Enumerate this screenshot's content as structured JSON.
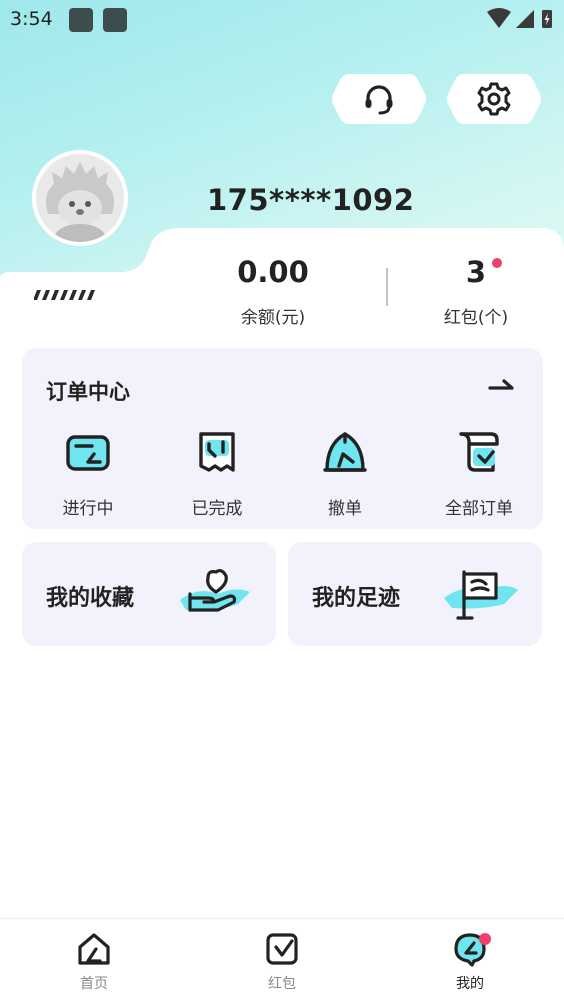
{
  "status_bar": {
    "time": "3:54"
  },
  "header": {
    "icons": {
      "support": "headset-icon",
      "settings": "gear-icon"
    },
    "phone": "175****1092"
  },
  "stats": {
    "balance": {
      "value": "0.00",
      "label": "余额(元)"
    },
    "redpacket": {
      "value": "3",
      "label": "红包(个)"
    }
  },
  "orders": {
    "title": "订单中心",
    "items": [
      {
        "label": "进行中",
        "icon": "in-progress-icon"
      },
      {
        "label": "已完成",
        "icon": "completed-icon"
      },
      {
        "label": "撤单",
        "icon": "cancel-order-icon"
      },
      {
        "label": "全部订单",
        "icon": "all-orders-icon"
      }
    ]
  },
  "tiles": {
    "favorites": {
      "label": "我的收藏",
      "icon": "heart-hand-icon"
    },
    "footprints": {
      "label": "我的足迹",
      "icon": "flag-icon"
    }
  },
  "nav": {
    "items": [
      {
        "label": "首页",
        "icon": "home-icon"
      },
      {
        "label": "红包",
        "icon": "redpacket-icon"
      },
      {
        "label": "我的",
        "icon": "profile-icon"
      }
    ]
  },
  "colors": {
    "accent": "#6fe6ef",
    "dark": "#1f1f1f",
    "card": "#f1f2fb",
    "dot": "#ef3f6a"
  }
}
